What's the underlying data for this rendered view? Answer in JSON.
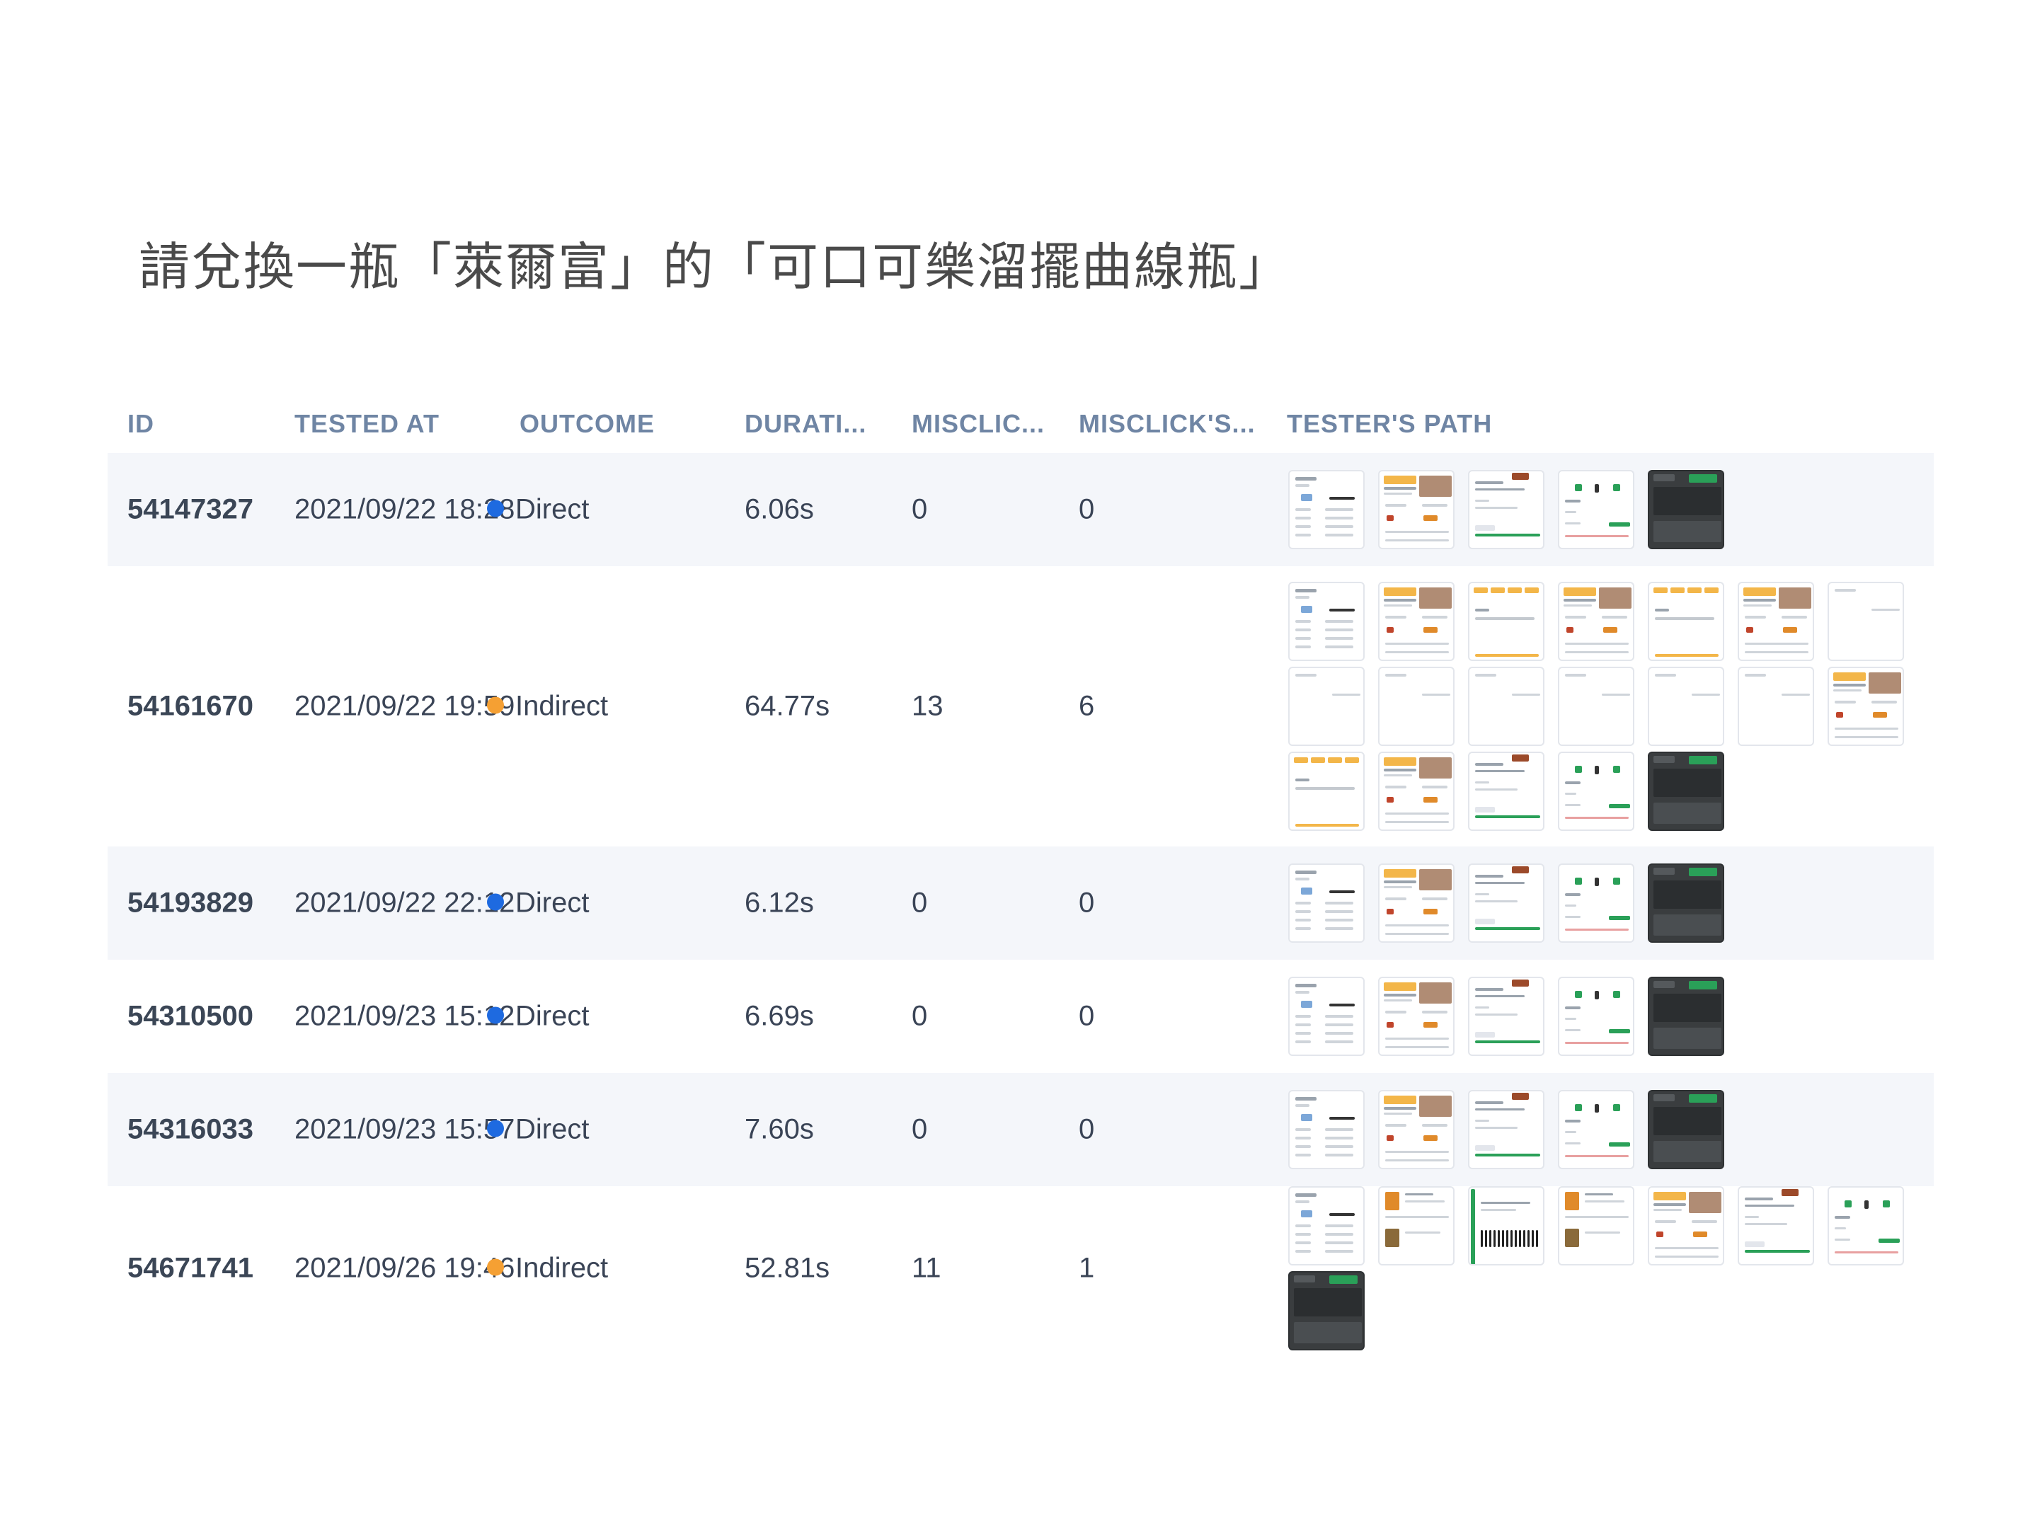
{
  "task_title": "請兌換一瓶「萊爾富」的「可口可樂溜擺曲線瓶」",
  "columns": [
    "ID",
    "TESTED AT",
    "OUTCOME",
    "DURATI...",
    "MISCLIC...",
    "MISCLICK'S...",
    "TESTER'S PATH"
  ],
  "colors": {
    "direct": "#1e6ae0",
    "indirect": "#f5a033",
    "row_alt": "#f4f6fa",
    "header_text": "#6f85a4"
  },
  "rows": [
    {
      "id": "54147327",
      "tested_at": "2021/09/22 18:28",
      "outcome": "Direct",
      "outcome_color": "#1e6ae0",
      "duration": "6.06s",
      "misclicks": "0",
      "misclick_s": "0",
      "path": [
        "menu",
        "banner",
        "product",
        "confirm",
        "dark"
      ]
    },
    {
      "id": "54161670",
      "tested_at": "2021/09/22 19:59",
      "outcome": "Indirect",
      "outcome_color": "#f5a033",
      "duration": "64.77s",
      "misclicks": "13",
      "misclick_s": "6",
      "path": [
        "menu",
        "banner",
        "tags",
        "banner",
        "tags",
        "banner",
        "blank",
        "blank",
        "blank",
        "blank",
        "blank",
        "blank",
        "blank",
        "banner",
        "tags",
        "banner",
        "product",
        "confirm",
        "dark"
      ]
    },
    {
      "id": "54193829",
      "tested_at": "2021/09/22 22:12",
      "outcome": "Direct",
      "outcome_color": "#1e6ae0",
      "duration": "6.12s",
      "misclicks": "0",
      "misclick_s": "0",
      "path": [
        "menu",
        "banner",
        "product",
        "confirm",
        "dark"
      ]
    },
    {
      "id": "54310500",
      "tested_at": "2021/09/23 15:12",
      "outcome": "Direct",
      "outcome_color": "#1e6ae0",
      "duration": "6.69s",
      "misclicks": "0",
      "misclick_s": "0",
      "path": [
        "menu",
        "banner",
        "product",
        "confirm",
        "dark"
      ]
    },
    {
      "id": "54316033",
      "tested_at": "2021/09/23 15:57",
      "outcome": "Direct",
      "outcome_color": "#1e6ae0",
      "duration": "7.60s",
      "misclicks": "0",
      "misclick_s": "0",
      "path": [
        "menu",
        "banner",
        "product",
        "confirm",
        "dark"
      ]
    },
    {
      "id": "54671741",
      "tested_at": "2021/09/26 19:46",
      "outcome": "Indirect",
      "outcome_color": "#f5a033",
      "duration": "52.81s",
      "misclicks": "11",
      "misclick_s": "1",
      "path": [
        "menu",
        "list",
        "barcode",
        "list",
        "banner",
        "product",
        "confirm",
        "dark"
      ]
    }
  ]
}
